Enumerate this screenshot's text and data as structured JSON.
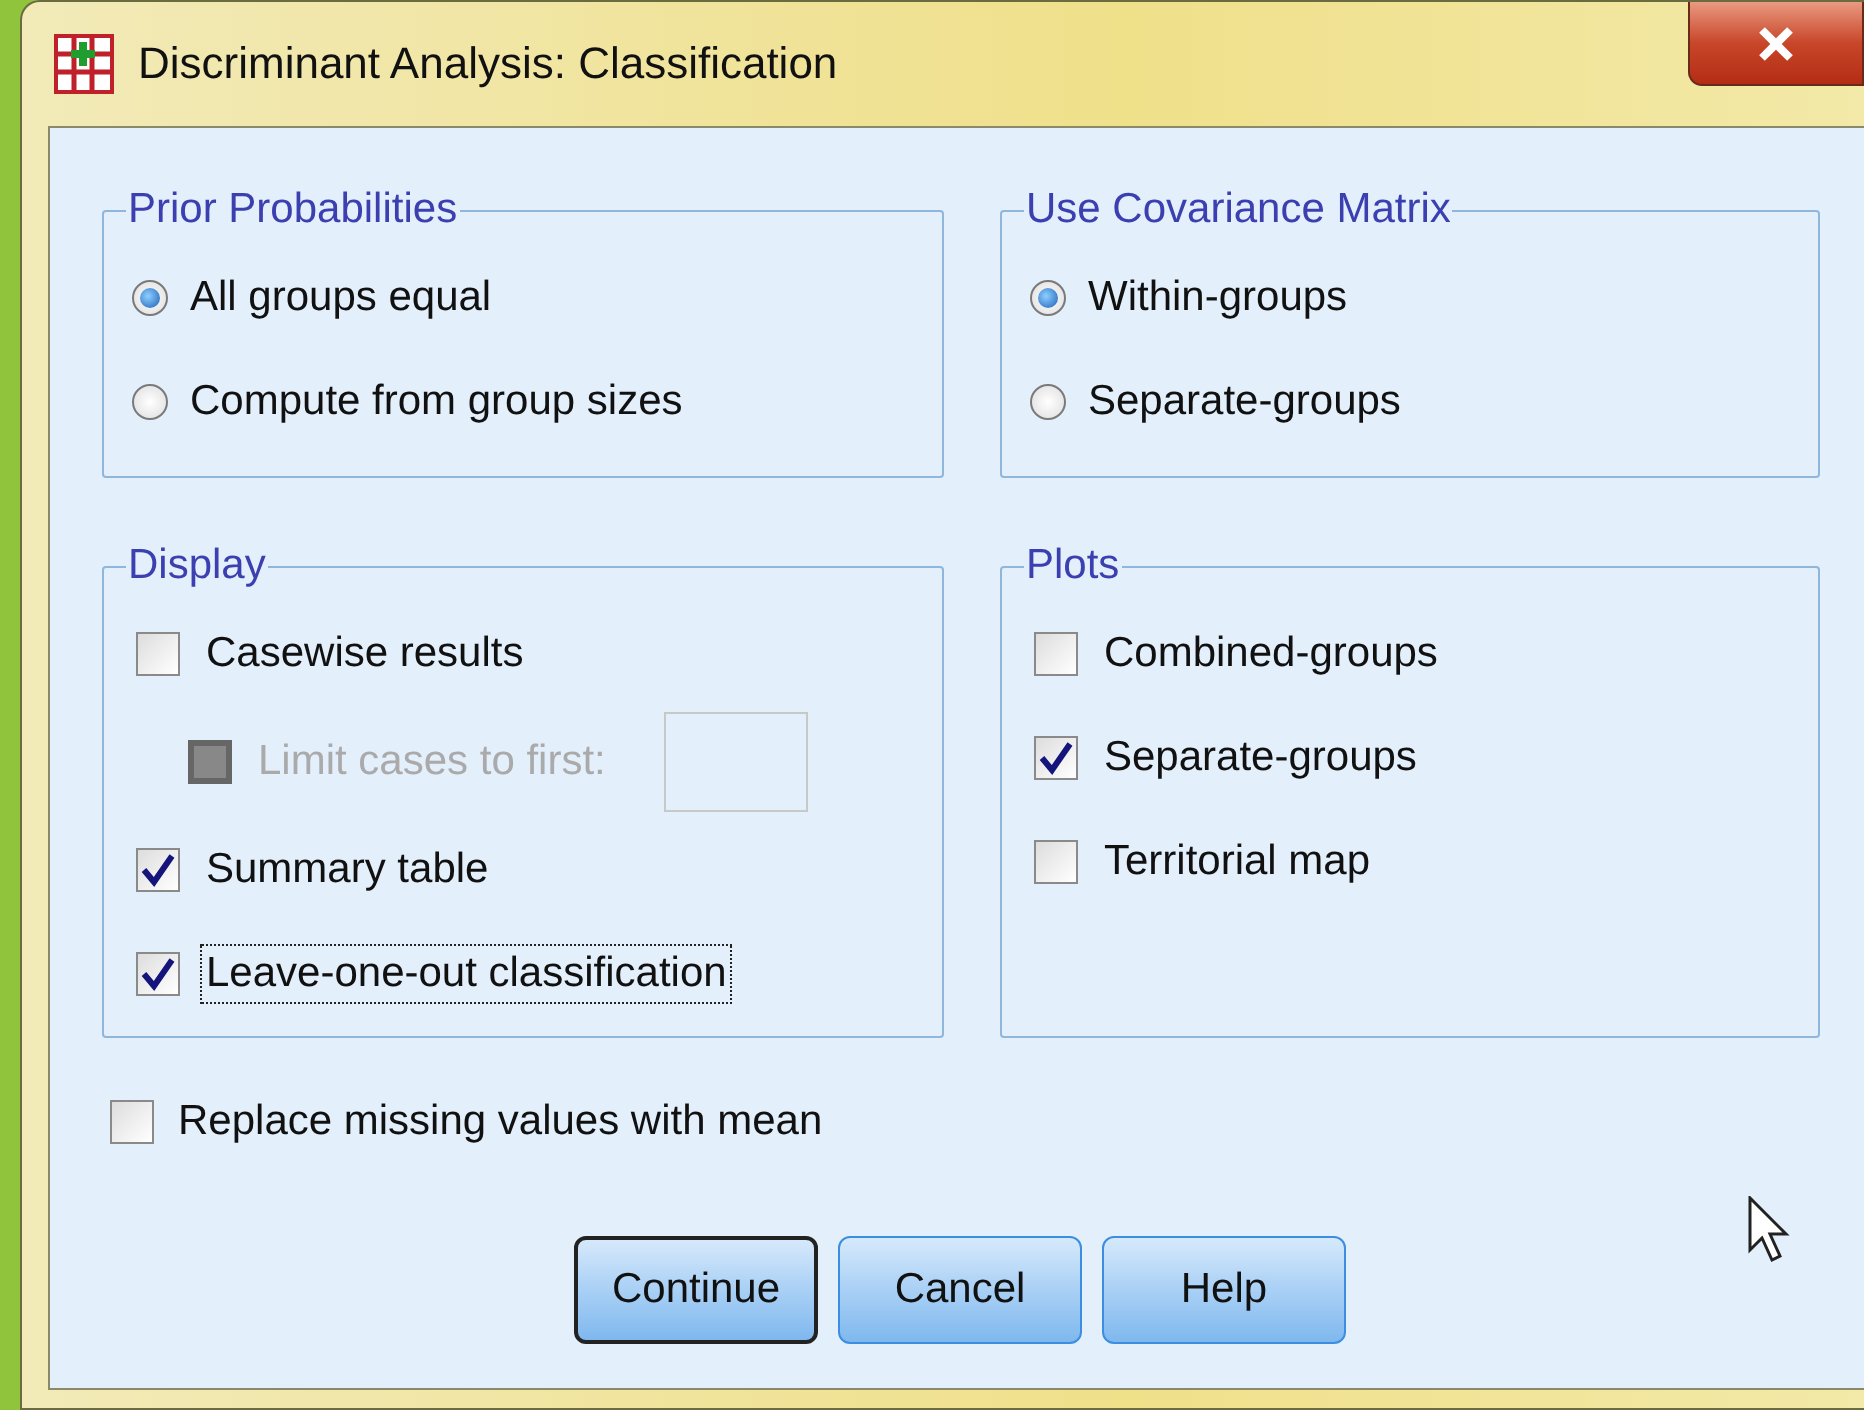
{
  "window": {
    "title": "Discriminant Analysis: Classification"
  },
  "groups": [
    {
      "title": "Prior Probabilities",
      "items": [
        {
          "kind": "radio",
          "label": "All groups equal",
          "selected": true
        },
        {
          "kind": "radio",
          "label": "Compute from group sizes",
          "selected": false
        }
      ]
    },
    {
      "title": "Use Covariance Matrix",
      "items": [
        {
          "kind": "radio",
          "label": "Within-groups",
          "selected": true
        },
        {
          "kind": "radio",
          "label": "Separate-groups",
          "selected": false
        }
      ]
    },
    {
      "title": "Display",
      "items": [
        {
          "kind": "checkbox",
          "label": "Casewise results",
          "checked": false,
          "disabled": false,
          "focused": false
        },
        {
          "kind": "limit",
          "label": "Limit cases to first:",
          "checked": false,
          "disabled": true,
          "focused": false
        },
        {
          "kind": "checkbox",
          "label": "Summary table",
          "checked": true,
          "disabled": false,
          "focused": false
        },
        {
          "kind": "checkbox",
          "label": "Leave-one-out classification",
          "checked": true,
          "disabled": false,
          "focused": true
        }
      ]
    },
    {
      "title": "Plots",
      "items": [
        {
          "kind": "checkbox",
          "label": "Combined-groups",
          "checked": false,
          "disabled": false,
          "focused": false
        },
        {
          "kind": "checkbox",
          "label": "Separate-groups",
          "checked": true,
          "disabled": false,
          "focused": false
        },
        {
          "kind": "checkbox",
          "label": "Territorial map",
          "checked": false,
          "disabled": false,
          "focused": false
        }
      ]
    }
  ],
  "replace_missing": {
    "label": "Replace missing values with mean",
    "checked": false
  },
  "buttons": [
    {
      "label": "Continue",
      "default": true
    },
    {
      "label": "Cancel",
      "default": false
    },
    {
      "label": "Help",
      "default": false
    }
  ]
}
